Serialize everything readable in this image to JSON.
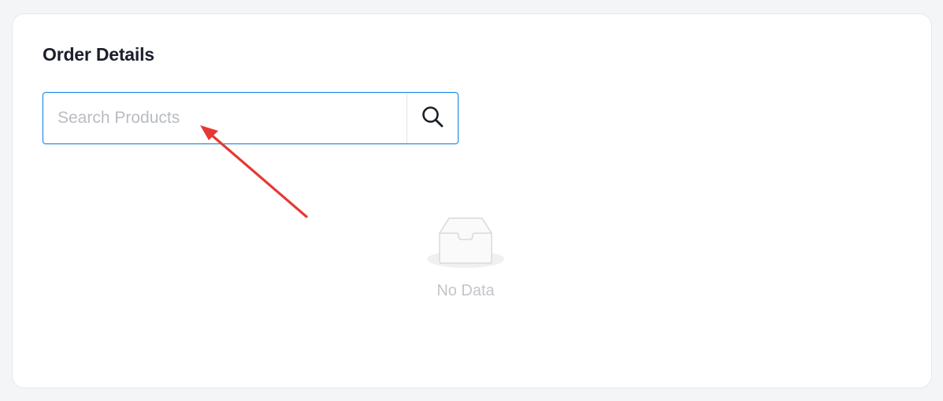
{
  "order": {
    "title": "Order Details",
    "search": {
      "placeholder": "Search Products",
      "value": ""
    },
    "empty_state": {
      "label": "No Data"
    }
  },
  "colors": {
    "accent": "#1e88e5",
    "annotation_arrow": "#e53935"
  },
  "icons": {
    "search": "search-icon",
    "empty": "empty-inbox-icon",
    "annotation": "arrow-annotation"
  }
}
